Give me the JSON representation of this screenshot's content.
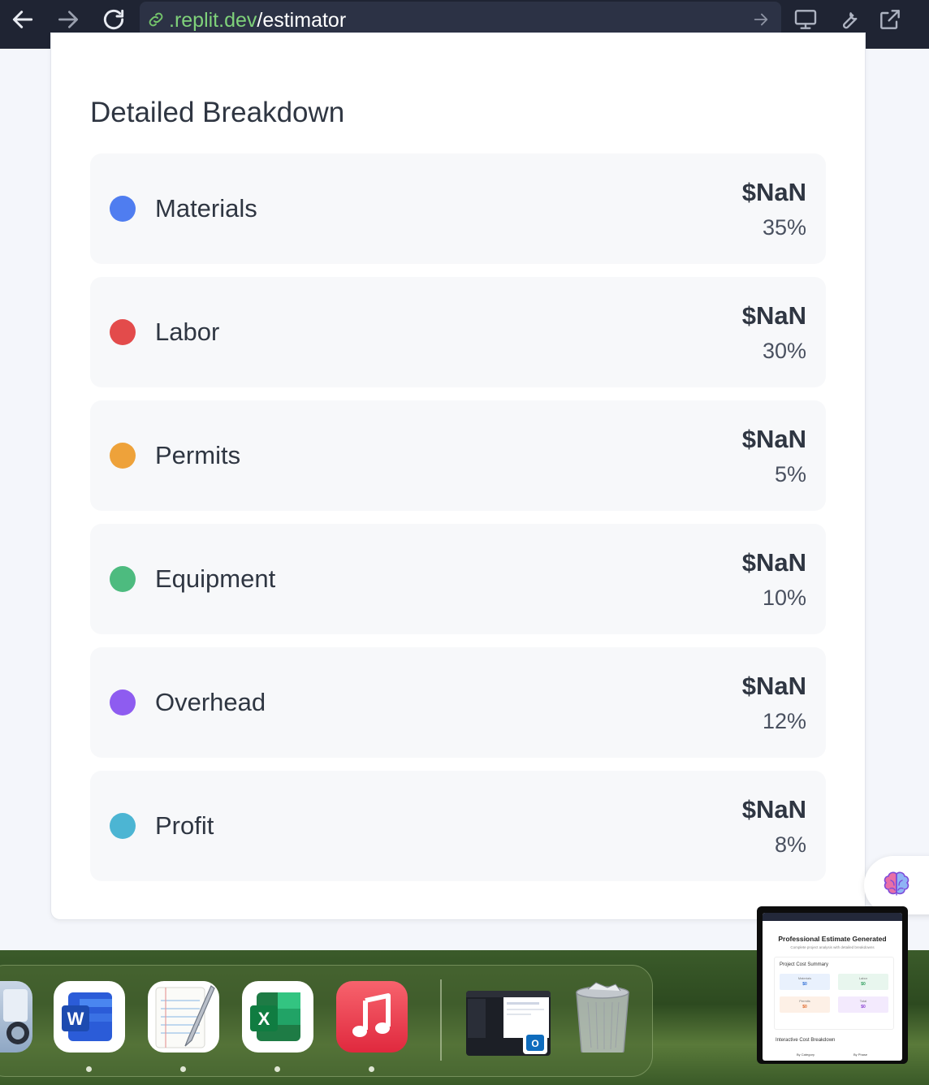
{
  "browser": {
    "url_domain": ".replit.dev",
    "url_path": "/estimator"
  },
  "breakdown": {
    "title": "Detailed Breakdown",
    "items": [
      {
        "label": "Materials",
        "amount": "$NaN",
        "percent": "35%",
        "color": "#4f7df0"
      },
      {
        "label": "Labor",
        "amount": "$NaN",
        "percent": "30%",
        "color": "#e34b4b"
      },
      {
        "label": "Permits",
        "amount": "$NaN",
        "percent": "5%",
        "color": "#eea23a"
      },
      {
        "label": "Equipment",
        "amount": "$NaN",
        "percent": "10%",
        "color": "#4dbb7f"
      },
      {
        "label": "Overhead",
        "amount": "$NaN",
        "percent": "12%",
        "color": "#8e5cf0"
      },
      {
        "label": "Profit",
        "amount": "$NaN",
        "percent": "8%",
        "color": "#4cb5d3"
      }
    ]
  },
  "dock": {
    "apps": [
      "Preview",
      "Microsoft Word",
      "TextEdit",
      "Microsoft Excel",
      "Music",
      "Outlook Window",
      "Trash"
    ]
  },
  "thumbnail": {
    "title": "Professional Estimate Generated",
    "subtitle": "Complete project analysis with detailed breakdowns",
    "summary_title": "Project Cost Summary",
    "cells": [
      {
        "label": "Materials",
        "value": "$0",
        "color": "#2f6fd6",
        "bg": "#e9f1fd"
      },
      {
        "label": "Labor",
        "value": "$0",
        "color": "#2f9e5c",
        "bg": "#e8f6ee"
      },
      {
        "label": "Permits",
        "value": "$0",
        "color": "#e0692b",
        "bg": "#fdf0e6"
      },
      {
        "label": "Total",
        "value": "$0",
        "color": "#8a3fd1",
        "bg": "#f3eafd"
      }
    ],
    "interactive_title": "Interactive Cost Breakdown",
    "tab_category": "By Category",
    "tab_phase": "By Phase"
  }
}
